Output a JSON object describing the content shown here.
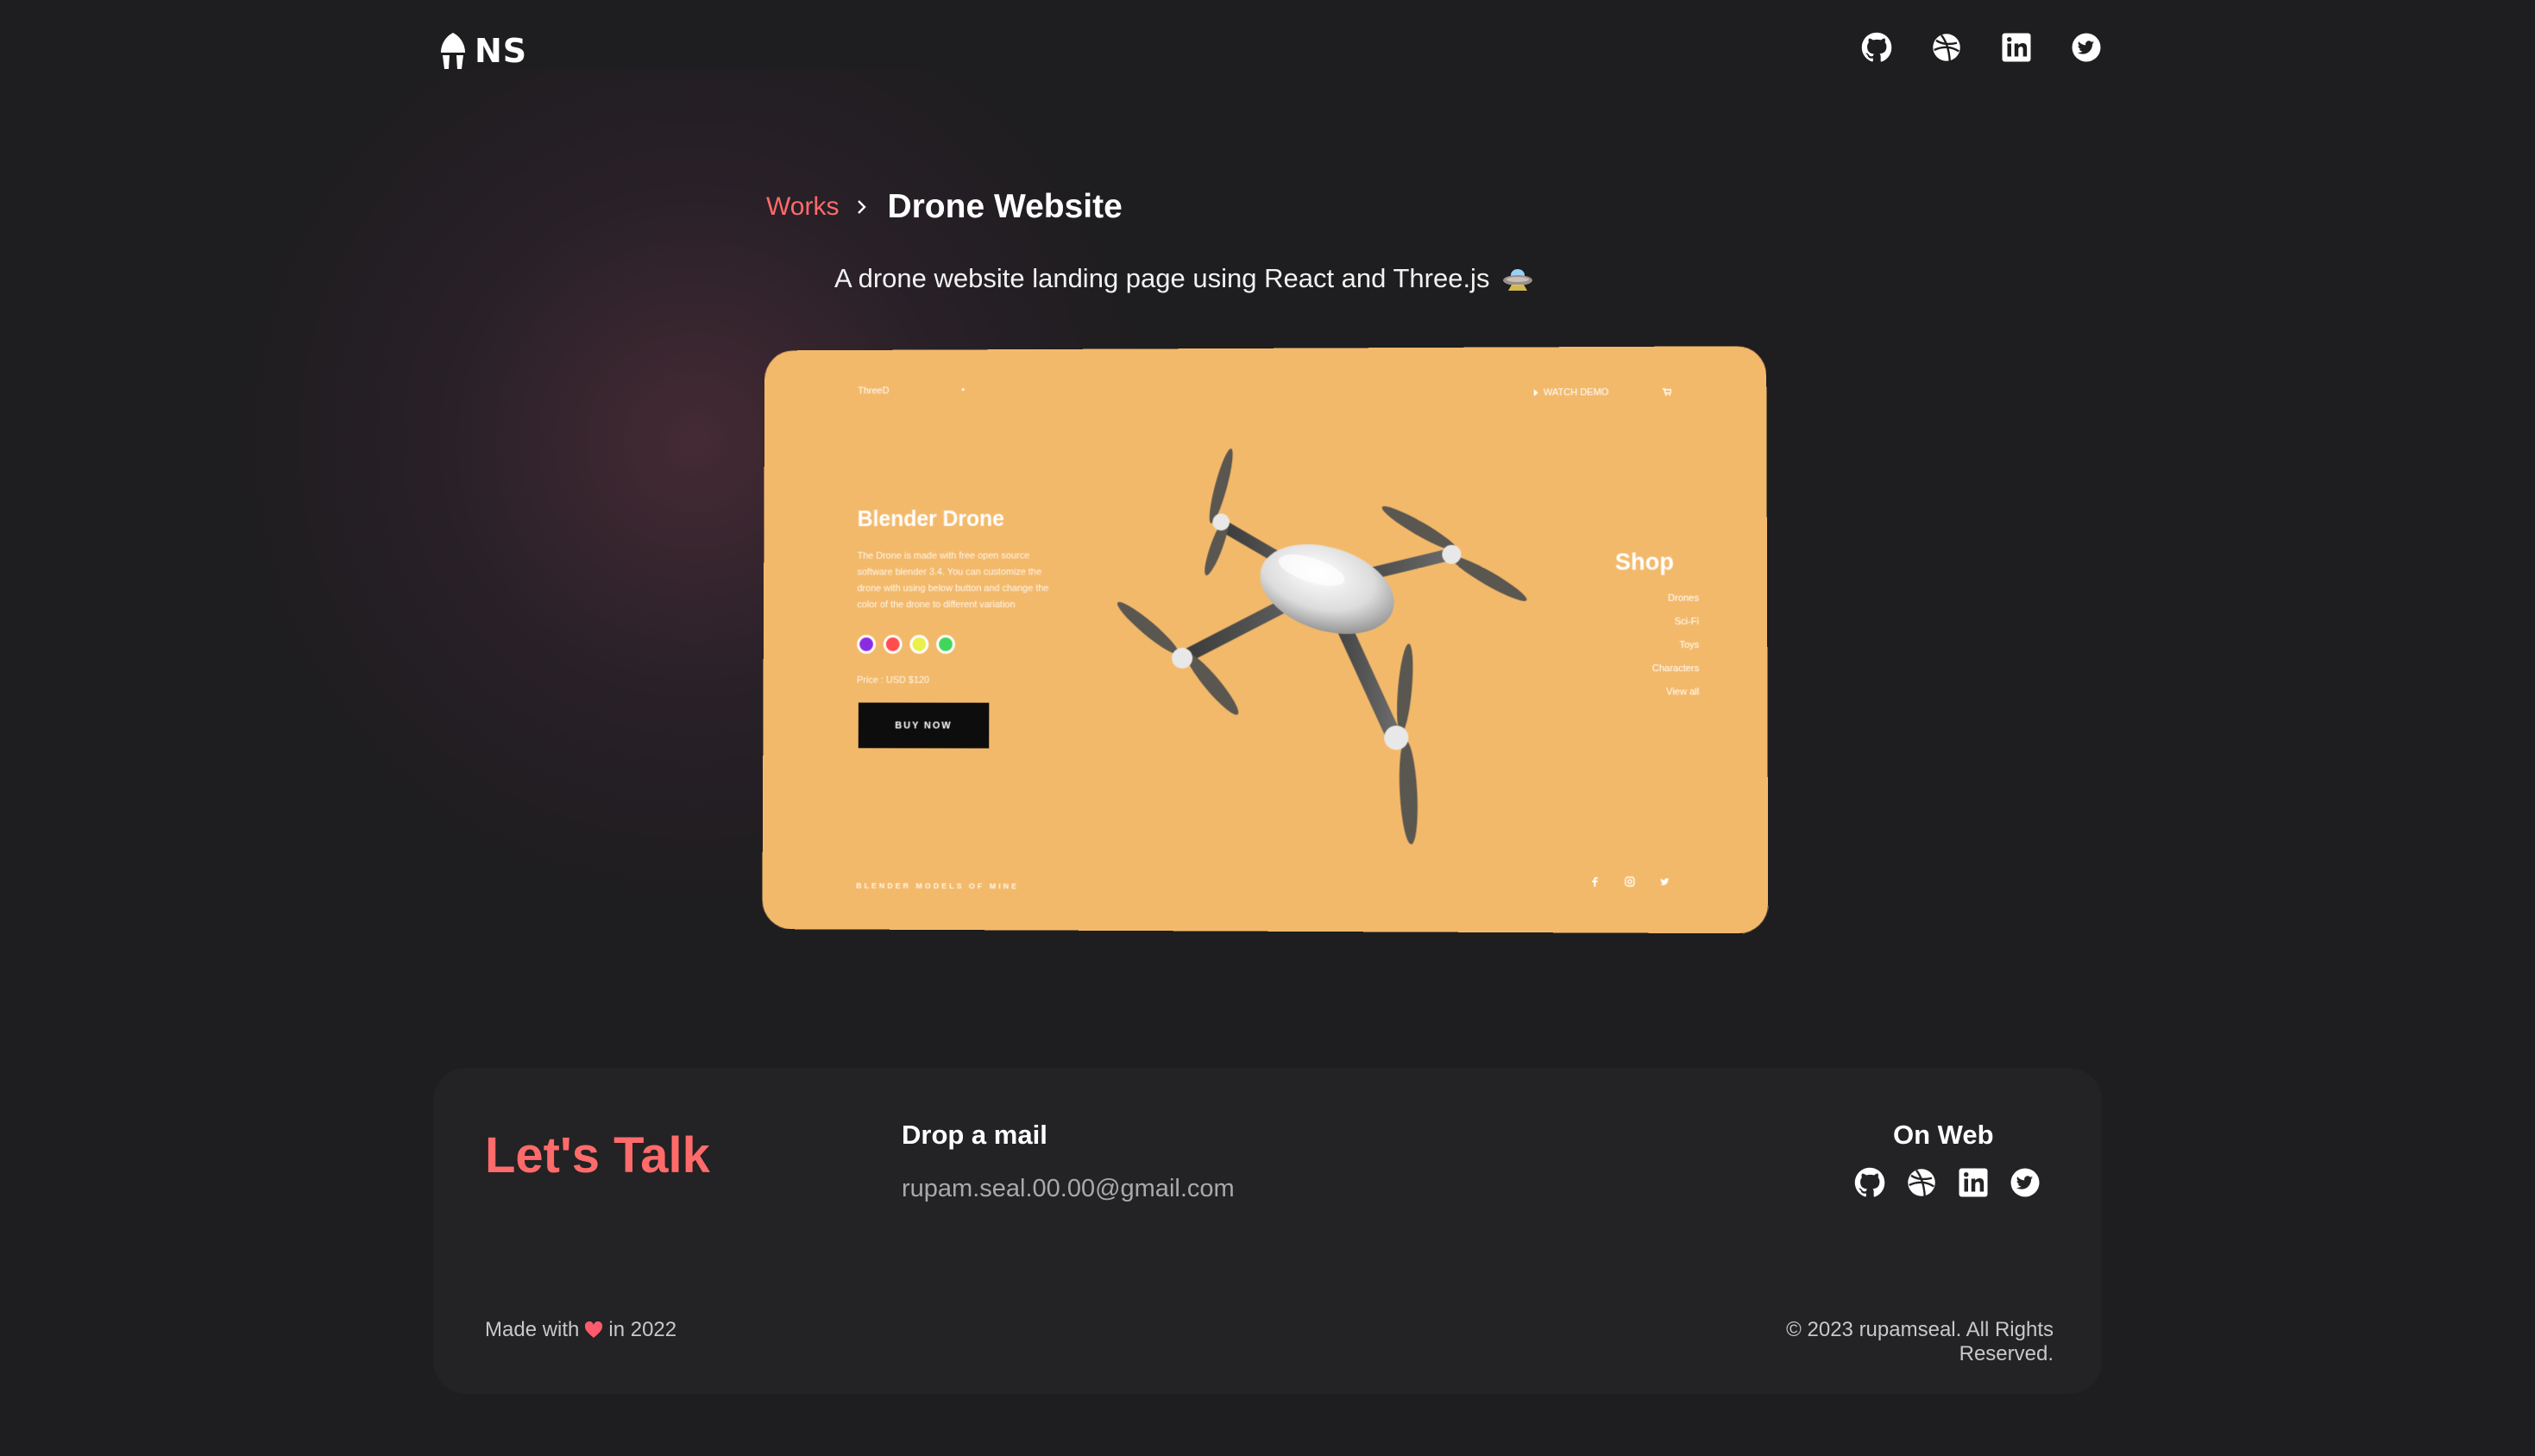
{
  "brand": {
    "logo_text": "NS"
  },
  "nav": {
    "social_icons": [
      "github-icon",
      "dribbble-icon",
      "linkedin-icon",
      "twitter-icon"
    ]
  },
  "breadcrumb": {
    "parent": "Works",
    "current": "Drone Website"
  },
  "subtitle": "A drone website landing page using React and Three.js",
  "preview": {
    "brand": "ThreeD",
    "watch_demo": "WATCH DEMO",
    "heading": "Blender Drone",
    "description": "The Drone is made with free open source software blender 3.4. You can customize the drone with using below button and change the color of the drone to different variation",
    "swatches": [
      "#8a2be2",
      "#ff4d4d",
      "#e9f04a",
      "#3fd65a"
    ],
    "price": "Price : USD $120",
    "buy_label": "BUY NOW",
    "shop_title": "Shop",
    "shop_items": [
      "Drones",
      "Sci-Fi",
      "Toys",
      "Characters",
      "View all"
    ],
    "footer_text": "BLENDER MODELS OF MINE",
    "social_icons": [
      "facebook-icon",
      "instagram-icon",
      "twitter-icon"
    ]
  },
  "contact": {
    "title": "Let's Talk",
    "mail_heading": "Drop a mail",
    "email": "rupam.seal.00.00@gmail.com",
    "web_heading": "On Web",
    "made_with_prefix": "Made with",
    "made_with_suffix": "in 2022",
    "copyright": "© 2023 rupamseal. All Rights Reserved."
  },
  "colors": {
    "accent": "#ff6b6b",
    "background": "#1e1d1f",
    "panel": "#232224",
    "preview_bg": "#f3b96b"
  }
}
